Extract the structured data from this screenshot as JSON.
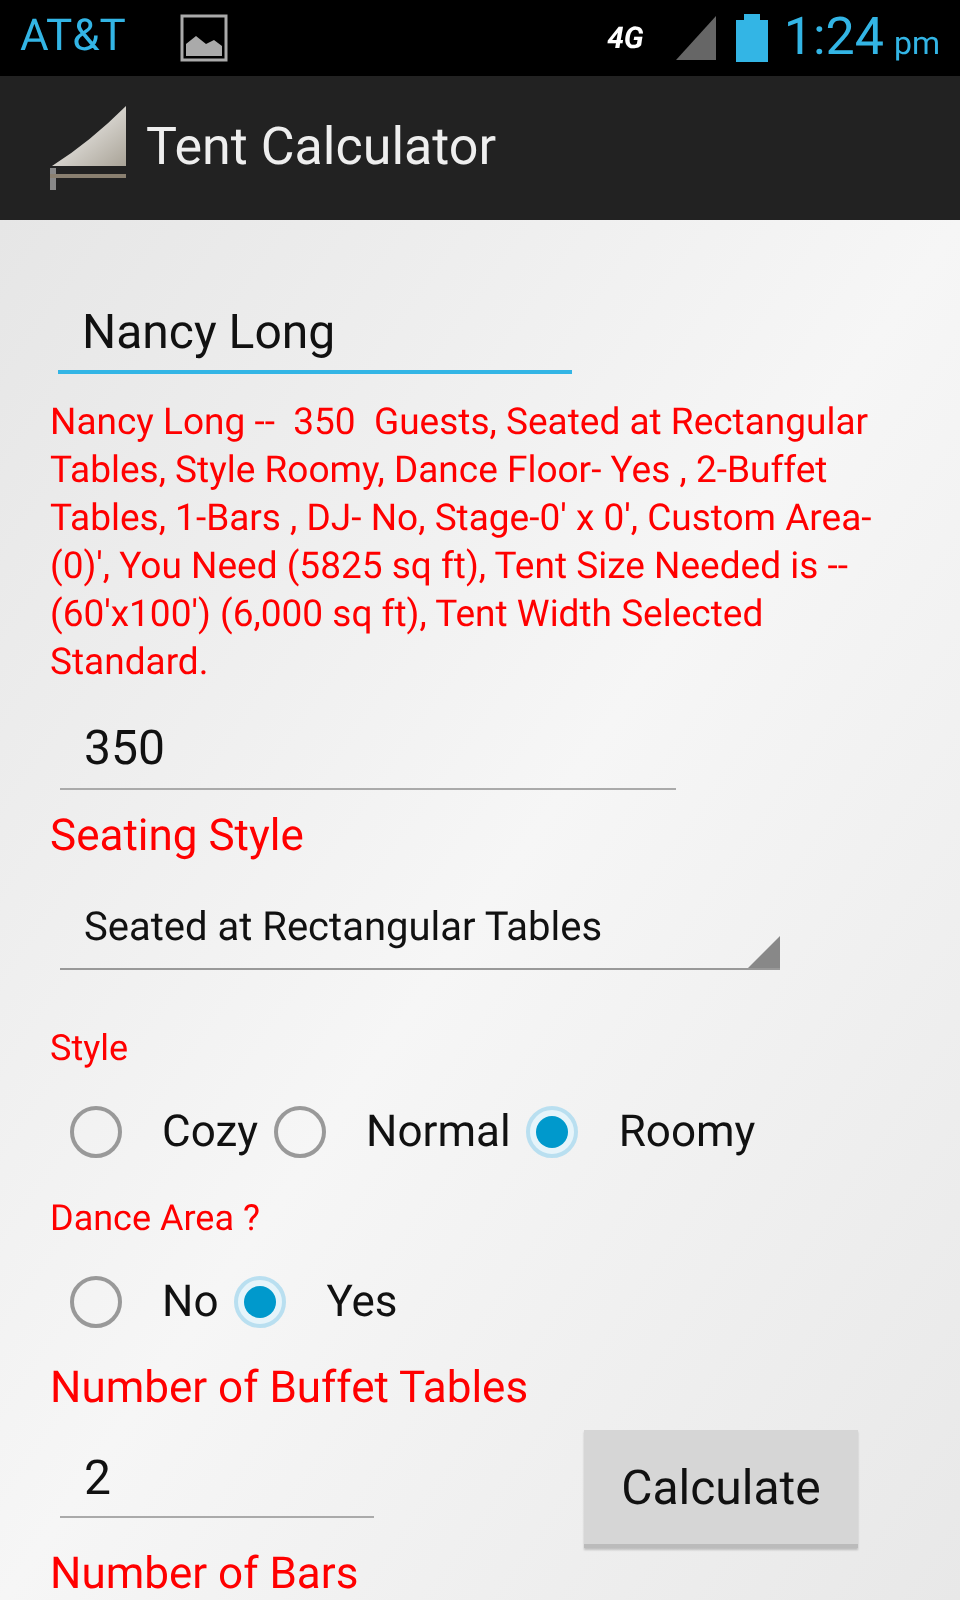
{
  "status_bar": {
    "carrier": "AT&T",
    "network": "4G",
    "time": "1:24",
    "period": "pm"
  },
  "action_bar": {
    "title": "Tent Calculator"
  },
  "form": {
    "name_field": {
      "value": "Nancy Long"
    },
    "summary": "Nancy Long --  350  Guests, Seated at Rectangular Tables, Style Roomy, Dance Floor- Yes , 2-Buffet Tables, 1-Bars , DJ- No, Stage-0' x 0', Custom Area-(0)', You Need (5825 sq ft), Tent Size Needed is -- (60'x100') (6,000 sq ft), Tent Width Selected Standard.",
    "guests_field": {
      "value": "350"
    },
    "seating_label": "Seating Style",
    "seating_spinner": {
      "value": "Seated at Rectangular Tables"
    },
    "style_label": "Style",
    "style_options": [
      {
        "label": "Cozy",
        "selected": false
      },
      {
        "label": "Normal",
        "selected": false
      },
      {
        "label": "Roomy",
        "selected": true
      }
    ],
    "dance_label": "Dance Area ?",
    "dance_options": [
      {
        "label": "No",
        "selected": false
      },
      {
        "label": "Yes",
        "selected": true
      }
    ],
    "buffet_label": "Number of Buffet Tables",
    "buffet_field": {
      "value": "2"
    },
    "calculate_button": "Calculate",
    "bars_label": "Number of Bars"
  }
}
